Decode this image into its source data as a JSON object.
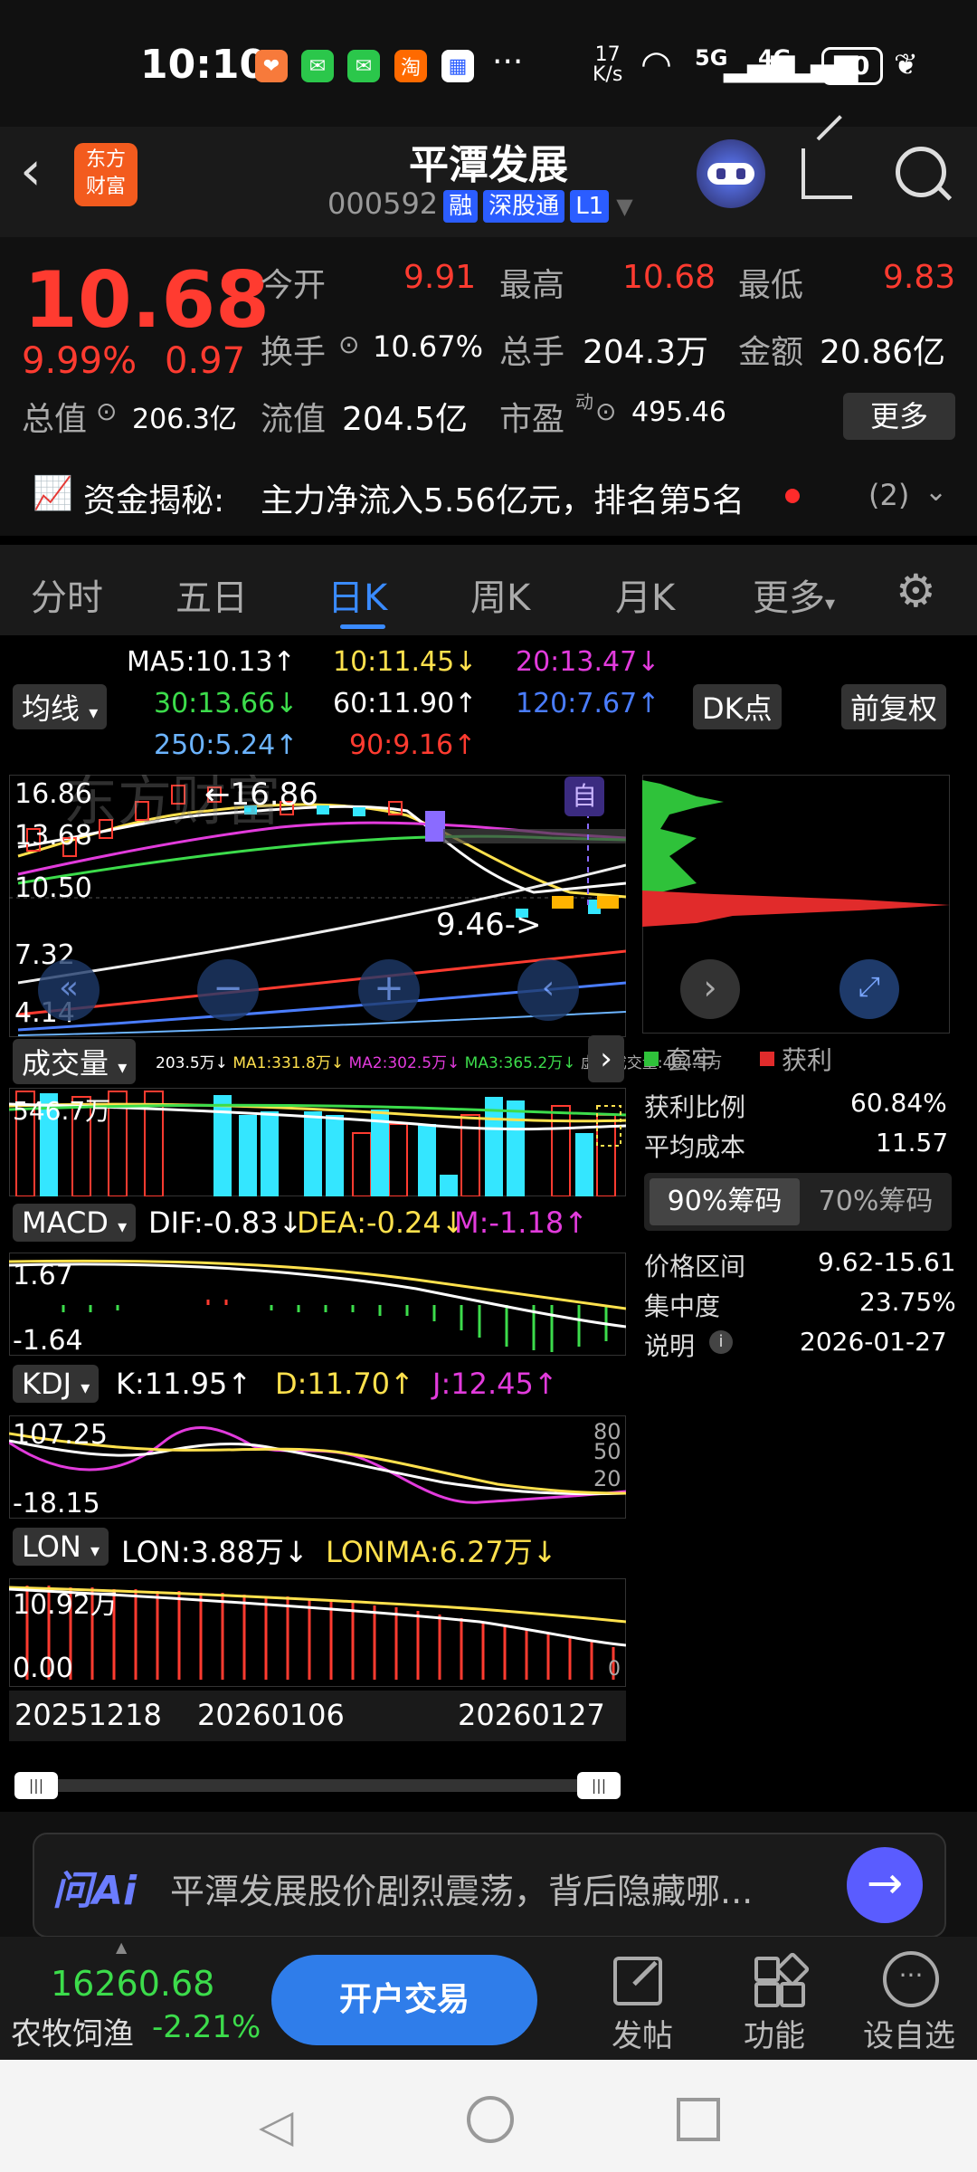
{
  "status": {
    "time": "10:10",
    "net_speed_top": "17",
    "net_speed_bottom": "K/s",
    "signal1": "5G",
    "signal2": "4G",
    "battery": "30"
  },
  "header": {
    "logo_line1": "东方",
    "logo_line2": "财富",
    "title": "平潭发展",
    "code": "000592",
    "tag1": "融",
    "tag2": "深股通",
    "tag3": "L1"
  },
  "quote": {
    "price": "10.68",
    "change_pct": "9.99%",
    "change": "0.97",
    "open_label": "今开",
    "open": "9.91",
    "high_label": "最高",
    "high": "10.68",
    "low_label": "最低",
    "low": "9.83",
    "turnover_label": "换手",
    "turnover": "10.67%",
    "volume_label": "总手",
    "volume": "204.3万",
    "amount_label": "金额",
    "amount": "20.86亿",
    "mktcap_label": "总值",
    "mktcap": "206.3亿",
    "float_label": "流值",
    "float": "204.5亿",
    "pe_label": "市盈",
    "pe_sup": "动",
    "pe": "495.46",
    "more": "更多"
  },
  "fund": {
    "label": "资金揭秘:",
    "text": "主力净流入5.56亿元，排名第5名",
    "count": "(2)"
  },
  "tabs": [
    "分时",
    "五日",
    "日K",
    "周K",
    "月K",
    "更多"
  ],
  "ma": {
    "button": "均线",
    "ma5": "MA5:10.13↑",
    "ma10": "10:11.45↓",
    "ma20": "20:13.47↓",
    "ma30": "30:13.66↓",
    "ma60": "60:11.90↑",
    "ma120": "120:7.67↑",
    "ma250": "250:5.24↑",
    "ma90": "90:9.16↑",
    "dk": "DK点",
    "fq": "前复权"
  },
  "kline": {
    "y_labels": [
      "16.86",
      "13.68",
      "10.50",
      "7.32",
      "4.14"
    ],
    "high_mark": "16.86",
    "low_mark": "9.46->",
    "auto": "自"
  },
  "chips": {
    "legend_trap": "套牢",
    "legend_profit": "获利",
    "profit_ratio_label": "获利比例",
    "profit_ratio": "60.84%",
    "avg_cost_label": "平均成本",
    "avg_cost": "11.57",
    "tab90": "90%筹码",
    "tab70": "70%筹码",
    "range_label": "价格区间",
    "range": "9.62-15.61",
    "concentration_label": "集中度",
    "concentration": "23.75%",
    "note_label": "说明",
    "note_date": "2026-01-27"
  },
  "volume": {
    "button": "成交量",
    "vol": "203.5万↓",
    "ma1": "MA1:331.8万↓",
    "ma2": "MA2:302.5万↓",
    "ma3": "MA3:365.2万↓",
    "virtual": "虚拟成交量:404.5万",
    "y_top": "546.7万"
  },
  "macd": {
    "button": "MACD",
    "dif": "DIF:-0.83↓",
    "dea": "DEA:-0.24↓",
    "m": "M:-1.18↑",
    "y_top": "1.67",
    "y_bot": "-1.64"
  },
  "kdj": {
    "button": "KDJ",
    "k": "K:11.95↑",
    "d": "D:11.70↑",
    "j": "J:12.45↑",
    "y_top": "107.25",
    "y_bot": "-18.15",
    "r80": "80",
    "r50": "50",
    "r20": "20"
  },
  "lon": {
    "button": "LON",
    "lon": "LON:3.88万↓",
    "lonma": "LONMA:6.27万↓",
    "y_top": "10.92万",
    "y_bot": "0.00",
    "zero": "0"
  },
  "xaxis": [
    "20251218",
    "20260106",
    "20260127"
  ],
  "ai": {
    "logo": "问Ai",
    "text": "平潭发展股价剧烈震荡，背后隐藏哪..."
  },
  "bottom": {
    "index_value": "16260.68",
    "index_name": "农牧饲渔",
    "index_change": "-2.21%",
    "trade": "开户交易",
    "post": "发帖",
    "func": "功能",
    "watch": "设自选"
  }
}
